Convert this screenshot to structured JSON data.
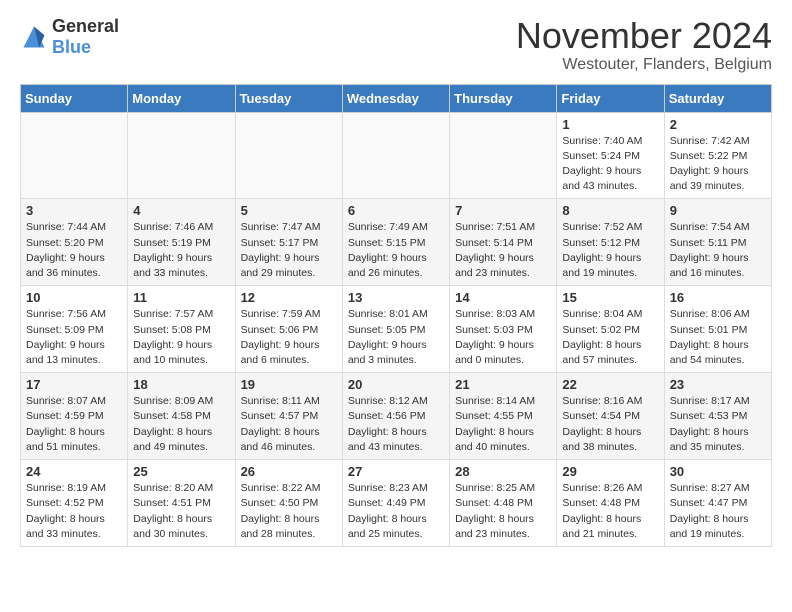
{
  "logo": {
    "general": "General",
    "blue": "Blue"
  },
  "title": "November 2024",
  "location": "Westouter, Flanders, Belgium",
  "weekdays": [
    "Sunday",
    "Monday",
    "Tuesday",
    "Wednesday",
    "Thursday",
    "Friday",
    "Saturday"
  ],
  "weeks": [
    [
      {
        "day": "",
        "info": ""
      },
      {
        "day": "",
        "info": ""
      },
      {
        "day": "",
        "info": ""
      },
      {
        "day": "",
        "info": ""
      },
      {
        "day": "",
        "info": ""
      },
      {
        "day": "1",
        "info": "Sunrise: 7:40 AM\nSunset: 5:24 PM\nDaylight: 9 hours and 43 minutes."
      },
      {
        "day": "2",
        "info": "Sunrise: 7:42 AM\nSunset: 5:22 PM\nDaylight: 9 hours and 39 minutes."
      }
    ],
    [
      {
        "day": "3",
        "info": "Sunrise: 7:44 AM\nSunset: 5:20 PM\nDaylight: 9 hours and 36 minutes."
      },
      {
        "day": "4",
        "info": "Sunrise: 7:46 AM\nSunset: 5:19 PM\nDaylight: 9 hours and 33 minutes."
      },
      {
        "day": "5",
        "info": "Sunrise: 7:47 AM\nSunset: 5:17 PM\nDaylight: 9 hours and 29 minutes."
      },
      {
        "day": "6",
        "info": "Sunrise: 7:49 AM\nSunset: 5:15 PM\nDaylight: 9 hours and 26 minutes."
      },
      {
        "day": "7",
        "info": "Sunrise: 7:51 AM\nSunset: 5:14 PM\nDaylight: 9 hours and 23 minutes."
      },
      {
        "day": "8",
        "info": "Sunrise: 7:52 AM\nSunset: 5:12 PM\nDaylight: 9 hours and 19 minutes."
      },
      {
        "day": "9",
        "info": "Sunrise: 7:54 AM\nSunset: 5:11 PM\nDaylight: 9 hours and 16 minutes."
      }
    ],
    [
      {
        "day": "10",
        "info": "Sunrise: 7:56 AM\nSunset: 5:09 PM\nDaylight: 9 hours and 13 minutes."
      },
      {
        "day": "11",
        "info": "Sunrise: 7:57 AM\nSunset: 5:08 PM\nDaylight: 9 hours and 10 minutes."
      },
      {
        "day": "12",
        "info": "Sunrise: 7:59 AM\nSunset: 5:06 PM\nDaylight: 9 hours and 6 minutes."
      },
      {
        "day": "13",
        "info": "Sunrise: 8:01 AM\nSunset: 5:05 PM\nDaylight: 9 hours and 3 minutes."
      },
      {
        "day": "14",
        "info": "Sunrise: 8:03 AM\nSunset: 5:03 PM\nDaylight: 9 hours and 0 minutes."
      },
      {
        "day": "15",
        "info": "Sunrise: 8:04 AM\nSunset: 5:02 PM\nDaylight: 8 hours and 57 minutes."
      },
      {
        "day": "16",
        "info": "Sunrise: 8:06 AM\nSunset: 5:01 PM\nDaylight: 8 hours and 54 minutes."
      }
    ],
    [
      {
        "day": "17",
        "info": "Sunrise: 8:07 AM\nSunset: 4:59 PM\nDaylight: 8 hours and 51 minutes."
      },
      {
        "day": "18",
        "info": "Sunrise: 8:09 AM\nSunset: 4:58 PM\nDaylight: 8 hours and 49 minutes."
      },
      {
        "day": "19",
        "info": "Sunrise: 8:11 AM\nSunset: 4:57 PM\nDaylight: 8 hours and 46 minutes."
      },
      {
        "day": "20",
        "info": "Sunrise: 8:12 AM\nSunset: 4:56 PM\nDaylight: 8 hours and 43 minutes."
      },
      {
        "day": "21",
        "info": "Sunrise: 8:14 AM\nSunset: 4:55 PM\nDaylight: 8 hours and 40 minutes."
      },
      {
        "day": "22",
        "info": "Sunrise: 8:16 AM\nSunset: 4:54 PM\nDaylight: 8 hours and 38 minutes."
      },
      {
        "day": "23",
        "info": "Sunrise: 8:17 AM\nSunset: 4:53 PM\nDaylight: 8 hours and 35 minutes."
      }
    ],
    [
      {
        "day": "24",
        "info": "Sunrise: 8:19 AM\nSunset: 4:52 PM\nDaylight: 8 hours and 33 minutes."
      },
      {
        "day": "25",
        "info": "Sunrise: 8:20 AM\nSunset: 4:51 PM\nDaylight: 8 hours and 30 minutes."
      },
      {
        "day": "26",
        "info": "Sunrise: 8:22 AM\nSunset: 4:50 PM\nDaylight: 8 hours and 28 minutes."
      },
      {
        "day": "27",
        "info": "Sunrise: 8:23 AM\nSunset: 4:49 PM\nDaylight: 8 hours and 25 minutes."
      },
      {
        "day": "28",
        "info": "Sunrise: 8:25 AM\nSunset: 4:48 PM\nDaylight: 8 hours and 23 minutes."
      },
      {
        "day": "29",
        "info": "Sunrise: 8:26 AM\nSunset: 4:48 PM\nDaylight: 8 hours and 21 minutes."
      },
      {
        "day": "30",
        "info": "Sunrise: 8:27 AM\nSunset: 4:47 PM\nDaylight: 8 hours and 19 minutes."
      }
    ]
  ]
}
